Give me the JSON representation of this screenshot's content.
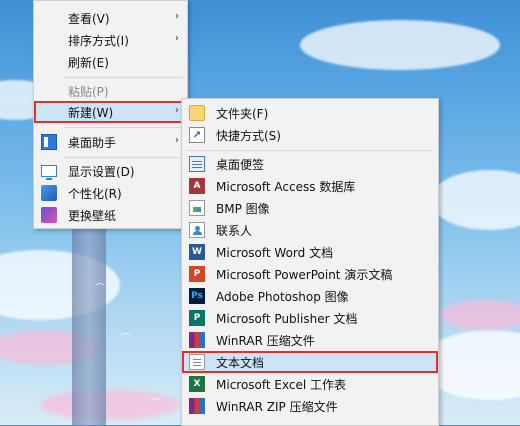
{
  "context_menu": {
    "items": [
      {
        "label": "查看(V)",
        "has_submenu": true,
        "icon": ""
      },
      {
        "label": "排序方式(I)",
        "has_submenu": true,
        "icon": ""
      },
      {
        "label": "刷新(E)",
        "has_submenu": false,
        "icon": ""
      },
      {
        "label": "粘贴(P)",
        "has_submenu": false,
        "disabled": true,
        "icon": ""
      },
      {
        "label": "新建(W)",
        "has_submenu": true,
        "highlighted": true,
        "icon": ""
      },
      {
        "label": "桌面助手",
        "has_submenu": true,
        "icon": "desktop-assistant-icon"
      },
      {
        "label": "显示设置(D)",
        "has_submenu": false,
        "icon": "display-settings-icon"
      },
      {
        "label": "个性化(R)",
        "has_submenu": false,
        "icon": "personalize-icon"
      },
      {
        "label": "更换壁纸",
        "has_submenu": false,
        "icon": "wallpaper-icon"
      }
    ],
    "arrow_glyph": "›"
  },
  "new_submenu": {
    "items": [
      {
        "label": "文件夹(F)",
        "icon": "folder-icon"
      },
      {
        "label": "快捷方式(S)",
        "icon": "shortcut-icon"
      },
      {
        "label": "桌面便签",
        "icon": "sticky-notes-icon"
      },
      {
        "label": "Microsoft Access 数据库",
        "icon": "access-icon"
      },
      {
        "label": "BMP 图像",
        "icon": "bmp-image-icon"
      },
      {
        "label": "联系人",
        "icon": "contact-icon"
      },
      {
        "label": "Microsoft Word 文档",
        "icon": "word-icon"
      },
      {
        "label": "Microsoft PowerPoint 演示文稿",
        "icon": "powerpoint-icon"
      },
      {
        "label": "Adobe Photoshop 图像",
        "icon": "photoshop-icon"
      },
      {
        "label": "Microsoft Publisher 文档",
        "icon": "publisher-icon"
      },
      {
        "label": "WinRAR 压缩文件",
        "icon": "winrar-icon"
      },
      {
        "label": "文本文档",
        "icon": "text-document-icon",
        "highlighted": true
      },
      {
        "label": "Microsoft Excel 工作表",
        "icon": "excel-icon"
      },
      {
        "label": "WinRAR ZIP 压缩文件",
        "icon": "winrar-zip-icon"
      }
    ]
  },
  "icon_glyphs": {
    "shortcut": "↗",
    "access": "A",
    "word": "W",
    "ppt": "P",
    "ps": "Ps",
    "pub": "P",
    "excel": "X"
  },
  "colors": {
    "highlight_fill": "#cce4f7",
    "highlight_border": "#e2312b",
    "menu_background": "#f2f2f2"
  }
}
